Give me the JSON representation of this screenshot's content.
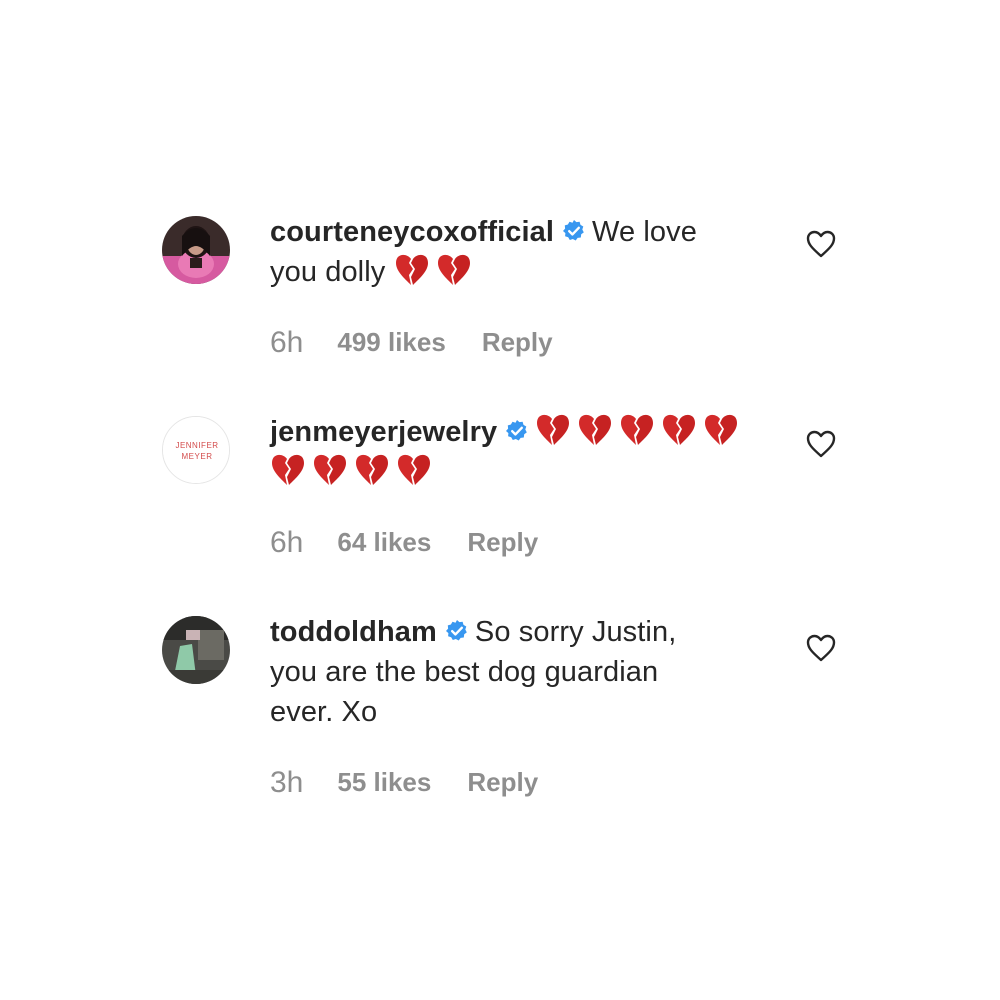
{
  "comments": [
    {
      "username": "courteneycoxofficial",
      "verified": true,
      "text_line1": "We love",
      "text_line2": "you dolly",
      "trailing_hearts": 2,
      "time": "6h",
      "likes": "499 likes",
      "reply": "Reply"
    },
    {
      "username": "jenmeyerjewelry",
      "verified": true,
      "avatar_text_line1": "JENNIFER",
      "avatar_text_line2": "MEYER",
      "hearts_line1": 5,
      "hearts_line2": 4,
      "time": "6h",
      "likes": "64 likes",
      "reply": "Reply"
    },
    {
      "username": "toddoldham",
      "verified": true,
      "text_line1": "So sorry Justin,",
      "text_line2": "you are the best dog guardian",
      "text_line3": "ever. Xo",
      "time": "3h",
      "likes": "55 likes",
      "reply": "Reply"
    }
  ],
  "icons": {
    "verified": "verified-badge-icon",
    "heart_emoji": "broken-heart-icon",
    "like": "heart-outline-icon"
  },
  "colors": {
    "text": "#262626",
    "meta": "#8e8e8e",
    "verified_blue": "#3897f0",
    "broken_heart_red": "#d32a2a",
    "avatar_border": "#dbdbdb"
  }
}
